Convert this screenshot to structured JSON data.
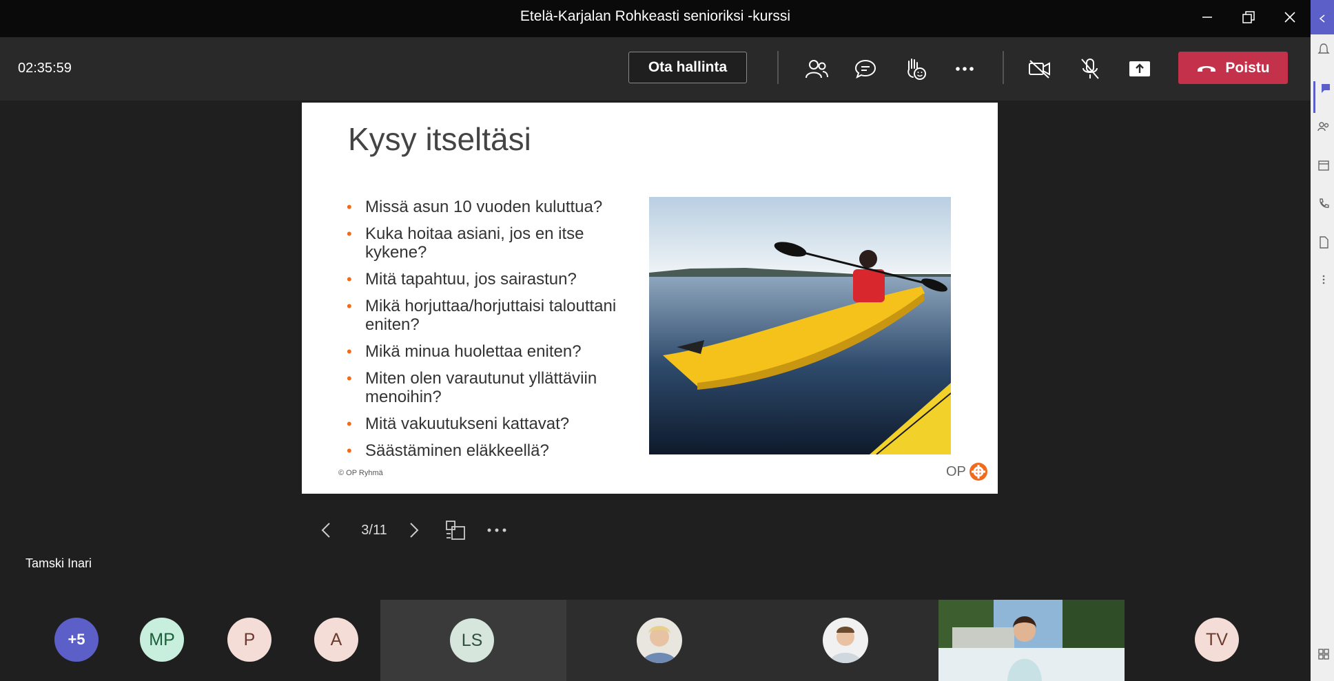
{
  "window": {
    "title": "Etelä-Karjalan Rohkeasti senioriksi -kurssi"
  },
  "toolbar": {
    "timer": "02:35:59",
    "take_control_label": "Ota hallinta",
    "leave_label": "Poistu"
  },
  "slide": {
    "title": "Kysy itseltäsi",
    "bullets": [
      "Missä asun 10 vuoden kuluttua?",
      "Kuka hoitaa asiani, jos en itse kykene?",
      "Mitä tapahtuu, jos sairastun?",
      "Mikä horjuttaa/horjuttaisi talouttani eniten?",
      "Mikä minua huolettaa eniten?",
      "Miten olen varautunut yllättäviin menoihin?",
      "Mitä vakuutukseni kattavat?",
      "Säästäminen eläkkeellä?"
    ],
    "copyright": "© OP Ryhmä",
    "logo_text": "OP"
  },
  "slide_controls": {
    "page": "3/11"
  },
  "presenter": {
    "name": "Tamski Inari"
  },
  "participants": {
    "overflow": "+5",
    "items": [
      {
        "initials": "MP",
        "color": "#c8eedd",
        "text_color": "#1b5e3a"
      },
      {
        "initials": "P",
        "color": "#f4dcd7",
        "text_color": "#6b3a2e"
      },
      {
        "initials": "A",
        "color": "#f4dcd7",
        "text_color": "#6b3a2e"
      },
      {
        "initials": "LS",
        "color": "#d6e6dc",
        "text_color": "#2f4f3c"
      },
      {
        "initials": "TV",
        "color": "#f4dcd7",
        "text_color": "#6b3a2e"
      }
    ]
  },
  "colors": {
    "accent": "#c4314b",
    "overflow_avatar": "#5b5fc7",
    "bullet": "#f26b1d"
  }
}
